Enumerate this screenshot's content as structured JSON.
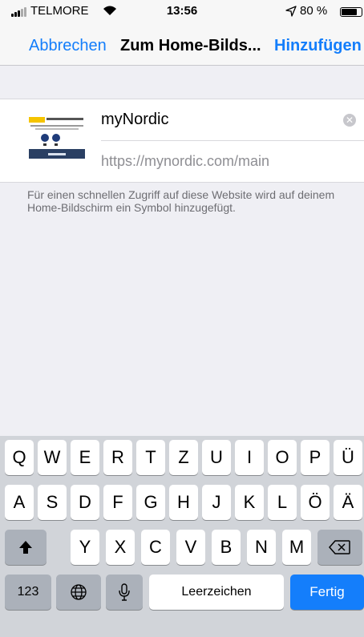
{
  "status_bar": {
    "carrier": "TELMORE",
    "time": "13:56",
    "battery_percent": "80 %",
    "battery_level": 0.8,
    "icons": [
      "signal-icon",
      "wifi-icon",
      "location-arrow-icon",
      "battery-icon"
    ]
  },
  "nav": {
    "cancel_label": "Abbrechen",
    "title": "Zum Home-Bilds...",
    "add_label": "Hinzufügen"
  },
  "form": {
    "name_value": "myNordic",
    "url": "https://mynordic.com/main",
    "clear_icon": "clear-icon"
  },
  "hint_text": "Für einen schnellen Zugriff auf diese Website wird auf deinem Home-Bildschirm ein Symbol hinzugefügt.",
  "keyboard": {
    "row1": [
      "Q",
      "W",
      "E",
      "R",
      "T",
      "Z",
      "U",
      "I",
      "O",
      "P",
      "Ü"
    ],
    "row2": [
      "A",
      "S",
      "D",
      "F",
      "G",
      "H",
      "J",
      "K",
      "L",
      "Ö",
      "Ä"
    ],
    "row3": [
      "Y",
      "X",
      "C",
      "V",
      "B",
      "N",
      "M"
    ],
    "numbers_label": "123",
    "space_label": "Leerzeichen",
    "return_label": "Fertig",
    "icons": [
      "shift-icon",
      "backspace-icon",
      "globe-icon",
      "microphone-icon"
    ]
  },
  "colors": {
    "accent": "#147efb",
    "background": "#efeff4",
    "keyboard_background": "#d1d4d9"
  }
}
